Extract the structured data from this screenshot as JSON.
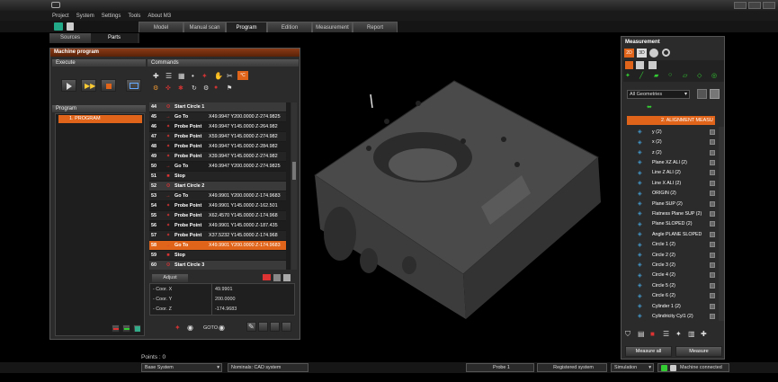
{
  "menu": [
    "Project",
    "System",
    "Settings",
    "Tools",
    "About M3"
  ],
  "left_tabs": [
    "Sources",
    "Parts"
  ],
  "main_tabs": [
    "Model",
    "Manual scan",
    "Program",
    "Edition",
    "Measurement",
    "Report"
  ],
  "machine_program": {
    "title": "Machine program",
    "execute_label": "Execute",
    "commands_label": "Commands",
    "program_label": "Program",
    "program_item": "1. PROGRAM",
    "adjust_label": "Adjust",
    "goto_label": "GOTO",
    "commands": [
      {
        "num": "44",
        "name": "Start Circle 1",
        "value": ""
      },
      {
        "num": "45",
        "name": "Go To",
        "value": "X49.9947 Y200.0000 Z-274.9825"
      },
      {
        "num": "46",
        "name": "Probe Point",
        "value": "X49.9947 Y145.0000 Z-264.982"
      },
      {
        "num": "47",
        "name": "Probe Point",
        "value": "X59.9947 Y145.0000 Z-274.982"
      },
      {
        "num": "48",
        "name": "Probe Point",
        "value": "X49.9947 Y145.0000 Z-284.982"
      },
      {
        "num": "49",
        "name": "Probe Point",
        "value": "X39.9947 Y145.0000 Z-274.982"
      },
      {
        "num": "50",
        "name": "Go To",
        "value": "X49.9947 Y200.0000 Z-274.9825"
      },
      {
        "num": "51",
        "name": "Stop",
        "value": ""
      },
      {
        "num": "52",
        "name": "Start Circle 2",
        "value": ""
      },
      {
        "num": "53",
        "name": "Go To",
        "value": "X49.9901 Y200.0000 Z-174.9683"
      },
      {
        "num": "54",
        "name": "Probe Point",
        "value": "X49.9901 Y145.0000 Z-162.501"
      },
      {
        "num": "55",
        "name": "Probe Point",
        "value": "X62.4570 Y145.0000 Z-174.968"
      },
      {
        "num": "56",
        "name": "Probe Point",
        "value": "X49.9901 Y145.0000 Z-187.435"
      },
      {
        "num": "57",
        "name": "Probe Point",
        "value": "X37.5232 Y145.0000 Z-174.968"
      },
      {
        "num": "58",
        "name": "Go To",
        "value": "X49.9901 Y200.0000 Z-174.9683"
      },
      {
        "num": "59",
        "name": "Stop",
        "value": ""
      },
      {
        "num": "60",
        "name": "Start Circle 3",
        "value": ""
      }
    ],
    "coords": [
      {
        "label": "- Coor. X",
        "value": "49.9901"
      },
      {
        "label": "- Coor. Y",
        "value": "200.0000"
      },
      {
        "label": "- Coor. Z",
        "value": "-174.9683"
      }
    ]
  },
  "measurement": {
    "title": "Measurement",
    "filter": "All Geometries",
    "root": "2. ALIGNMENT MEASU",
    "items": [
      "y (2)",
      "x (2)",
      "z (2)",
      "Plane XZ ALI (2)",
      "Line Z ALI (2)",
      "Line X ALI (2)",
      "ORIGIN (2)",
      "Plane SUP (2)",
      "Flatness Plane SUP (2)",
      "Plane SLOPED (2)",
      "Angle PLANE SLOPED",
      "Circle 1 (2)",
      "Circle 2 (2)",
      "Circle 3 (2)",
      "Circle 4 (2)",
      "Circle 5 (2)",
      "Circle 6 (2)",
      "Cylinder 1 (2)",
      "Cylindricity Cyl1 (2)"
    ],
    "measure_all": "Measure all",
    "measure": "Measure"
  },
  "points_label": "Points : 0",
  "status": {
    "base_system": "Base System",
    "nominals": "Nominals: CAD system",
    "probe": "Probe 1",
    "registered": "Registered system",
    "simulation": "Simulation",
    "machine": "Machine connected"
  },
  "colors": {
    "accent": "#e0641a",
    "panel": "#2b2b2b",
    "part": "#444444"
  }
}
